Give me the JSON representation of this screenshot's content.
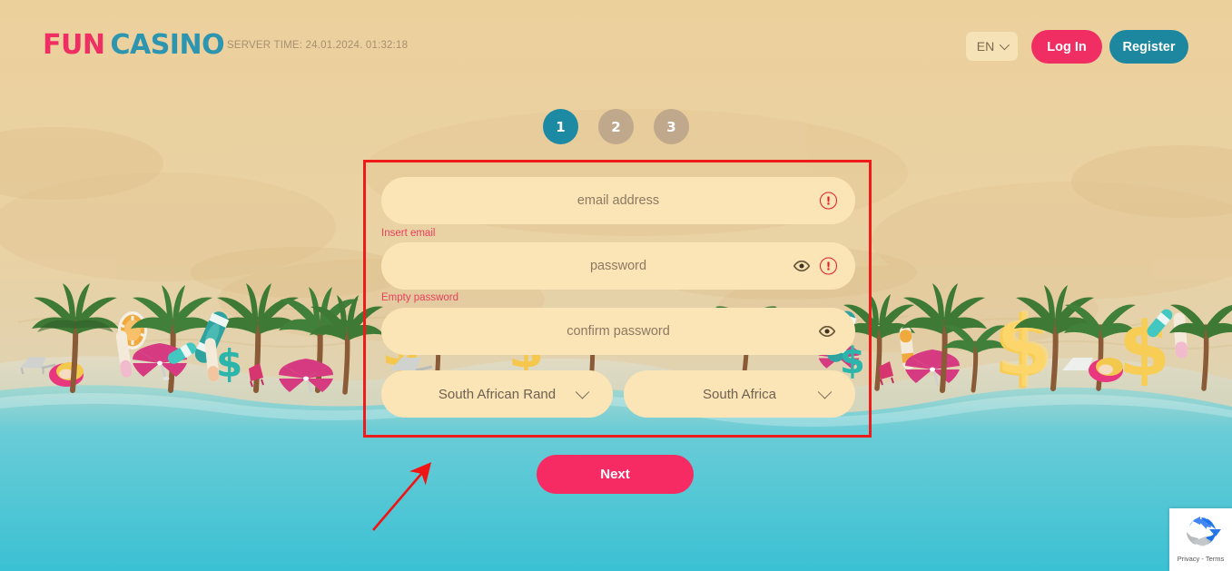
{
  "header": {
    "logo": {
      "part1": "FUN",
      "part2": "CASINO",
      "part1_color": "#ef2f63",
      "part2_color": "#2d95b0"
    },
    "server_time": "SERVER TIME: 24.01.2024. 01:32:18",
    "language_selected": "EN",
    "language_chevron_icon": "chevron-down-icon",
    "login_label": "Log In",
    "register_label": "Register",
    "login_color": "#f02e63",
    "register_color": "#1d87a0"
  },
  "steps": {
    "items": [
      {
        "label": "1",
        "state": "active"
      },
      {
        "label": "2",
        "state": "inactive"
      },
      {
        "label": "3",
        "state": "inactive"
      }
    ],
    "active_color": "#1d8aa4",
    "inactive_color": "#bfa88b"
  },
  "form": {
    "highlight_color": "#ee1b1b",
    "email": {
      "placeholder": "email address",
      "value": "",
      "error": "Insert email",
      "error_icon": "error-circle-icon"
    },
    "password": {
      "placeholder": "password",
      "value": "",
      "error": "Empty password",
      "error_icon": "error-circle-icon",
      "reveal_icon": "eye-icon"
    },
    "confirm_password": {
      "placeholder": "confirm password",
      "value": "",
      "error": "",
      "reveal_icon": "eye-icon"
    },
    "currency": {
      "selected": "South African Rand",
      "chevron_icon": "chevron-down-icon"
    },
    "country": {
      "selected": "South Africa",
      "chevron_icon": "chevron-down-icon"
    },
    "error_text_color": "#e8405c",
    "field_bg": "#fbe4b6"
  },
  "next_button": {
    "label": "Next",
    "color": "#f72b63"
  },
  "recaptcha": {
    "text": "Privacy - Terms",
    "logo_icon": "recaptcha-icon"
  },
  "annotation": {
    "arrow_icon": "red-arrow-icon",
    "color": "#ee1b1b"
  },
  "theme": {
    "sand": "#ecd09c",
    "ocean": "#3bc1d4",
    "field_text": "#8b7a63"
  }
}
